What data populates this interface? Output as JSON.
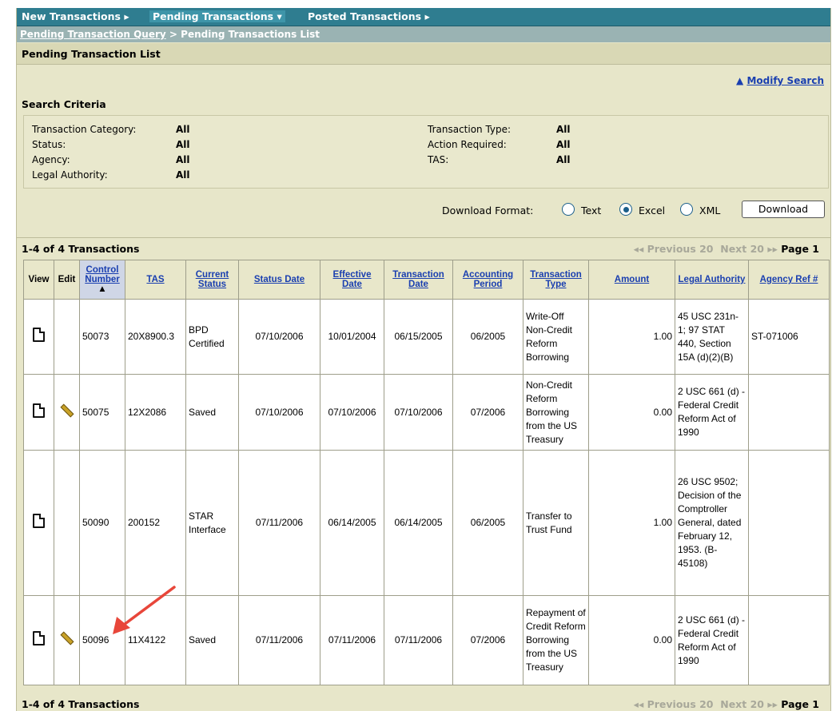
{
  "nav": {
    "new": "New Transactions",
    "pending": "Pending Transactions",
    "posted": "Posted Transactions"
  },
  "breadcrumb": {
    "link": "Pending Transaction Query",
    "separator": ">",
    "current": "Pending Transactions List"
  },
  "section_title": "Pending Transaction List",
  "modify_search": "Modify Search",
  "search_criteria": {
    "title": "Search Criteria",
    "left": [
      {
        "label": "Transaction Category:",
        "value": "All"
      },
      {
        "label": "Status:",
        "value": "All"
      },
      {
        "label": "Agency:",
        "value": "All"
      },
      {
        "label": "Legal Authority:",
        "value": "All"
      }
    ],
    "right": [
      {
        "label": "Transaction Type:",
        "value": "All"
      },
      {
        "label": "Action Required:",
        "value": "All"
      },
      {
        "label": "TAS:",
        "value": "All"
      }
    ]
  },
  "download": {
    "label": "Download Format:",
    "options": [
      "Text",
      "Excel",
      "XML"
    ],
    "selected": "Excel",
    "button": "Download"
  },
  "count_text": "1-4 of 4 Transactions",
  "pager": {
    "previous": "Previous 20",
    "next": "Next 20",
    "page": "Page 1"
  },
  "columns": [
    "View",
    "Edit",
    "Control Number",
    "TAS",
    "Current Status",
    "Status Date",
    "Effective Date",
    "Transaction Date",
    "Accounting Period",
    "Transaction Type",
    "Amount",
    "Legal Authority",
    "Agency Ref #"
  ],
  "rows": [
    {
      "editable": false,
      "control": "50073",
      "tas": "20X8900.3",
      "status": "BPD Certified",
      "status_date": "07/10/2006",
      "effective_date": "10/01/2004",
      "transaction_date": "06/15/2005",
      "period": "06/2005",
      "type": "Write-Off Non-Credit Reform Borrowing",
      "amount": "1.00",
      "legal": "45 USC 231n-1; 97 STAT 440, Section 15A (d)(2)(B)",
      "agency_ref": "ST-071006"
    },
    {
      "editable": true,
      "control": "50075",
      "tas": "12X2086",
      "status": "Saved",
      "status_date": "07/10/2006",
      "effective_date": "07/10/2006",
      "transaction_date": "07/10/2006",
      "period": "07/2006",
      "type": "Non-Credit Reform Borrowing from the US Treasury",
      "amount": "0.00",
      "legal": "2 USC 661 (d) - Federal Credit Reform Act of 1990",
      "agency_ref": ""
    },
    {
      "editable": false,
      "control": "50090",
      "tas": "200152",
      "status": "STAR Interface",
      "status_date": "07/11/2006",
      "effective_date": "06/14/2005",
      "transaction_date": "06/14/2005",
      "period": "06/2005",
      "type": "Transfer to Trust Fund",
      "amount": "1.00",
      "legal": "26 USC 9502; Decision of the Comptroller General, dated February 12, 1953. (B-45108)",
      "agency_ref": ""
    },
    {
      "editable": true,
      "control": "50096",
      "tas": "11X4122",
      "status": "Saved",
      "status_date": "07/11/2006",
      "effective_date": "07/11/2006",
      "transaction_date": "07/11/2006",
      "period": "07/2006",
      "type": "Repayment of Credit Reform Borrowing from the US Treasury",
      "amount": "0.00",
      "legal": "2 USC 661 (d) - Federal Credit Reform Act of 1990",
      "agency_ref": ""
    }
  ],
  "colors": {
    "nav_bg": "#2f7d90",
    "panel_bg": "#e7e6c9",
    "link": "#1a3fb0",
    "annotation_arrow": "#e8463a"
  }
}
